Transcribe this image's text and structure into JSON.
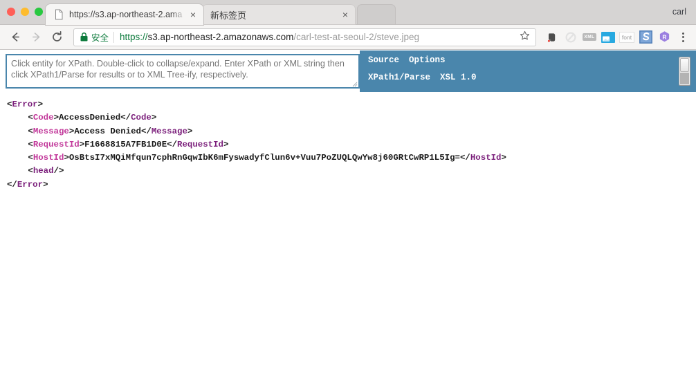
{
  "window": {
    "profile_name": "carl",
    "traffic_lights": [
      "close",
      "minimize",
      "zoom"
    ]
  },
  "tabs": [
    {
      "title": "https://s3.ap-northeast-2.ama",
      "favicon": "document-icon",
      "active": true,
      "close_label": "×"
    },
    {
      "title": "新标签页",
      "favicon": "none",
      "active": false,
      "close_label": "×"
    }
  ],
  "toolbar": {
    "back_label": "←",
    "forward_label": "→",
    "reload_label": "↻",
    "security_text": "安全",
    "url": {
      "scheme": "https://",
      "host": "s3.ap-northeast-2.amazonaws.com",
      "path": "/carl-test-at-seoul-2/steve.jpeg"
    },
    "bookmark_label": "☆",
    "extensions": [
      {
        "name": "evernote-icon",
        "label": ""
      },
      {
        "name": "adblock-icon",
        "label": ""
      },
      {
        "name": "xml-viewer-icon",
        "label": "XML"
      },
      {
        "name": "screenshot-icon",
        "label": ""
      },
      {
        "name": "font-inspector-icon",
        "label": "font"
      },
      {
        "name": "scribd-icon",
        "label": "S"
      },
      {
        "name": "r-extension-icon",
        "label": "R"
      }
    ],
    "menu_label": "⋮"
  },
  "xpath_tool": {
    "instructions": "Click entity for XPath. Double-click to collapse/expand. Enter XPath or XML string then click XPath1/Parse for results or to XML Tree-ify, respectively.",
    "input_value": "",
    "menu_row1": [
      "Source",
      "Options"
    ],
    "menu_row2": [
      "XPath1/Parse",
      "XSL 1.0"
    ],
    "panel_color": "#4a86ac"
  },
  "xml_document": {
    "root_open": "Error",
    "root_close": "Error",
    "nodes": [
      {
        "tag": "Code",
        "value": "AccessDenied"
      },
      {
        "tag": "Message",
        "value": "Access Denied"
      },
      {
        "tag": "RequestId",
        "value": "F1668815A7FB1D0E"
      },
      {
        "tag": "HostId",
        "value": "OsBtsI7xMQiMfqun7cphRnGqwIbK6mFyswadyfClun6v+Vuu7PoZUQLQwYw8j60GRtCwRP1L5Ig="
      }
    ],
    "self_closing": "head",
    "tag_color": "#7b1f7b",
    "alt_tag_color": "#c2389a",
    "text_color": "#1a1a1a"
  }
}
